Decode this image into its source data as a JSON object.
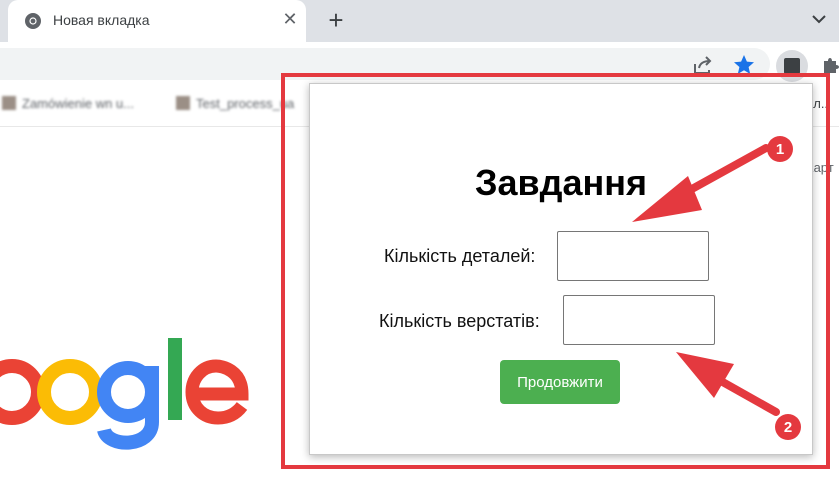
{
  "browser": {
    "tab_title": "Новая вкладка",
    "new_tab_symbol": "+",
    "tab_close_symbol": "✕",
    "bookmarks": [
      "Zamówienie wn u...",
      "Test_process_ua"
    ],
    "bookmarks_right": "ал..",
    "side_text": "Карт"
  },
  "popup": {
    "title": "Завдання",
    "fields": [
      {
        "label": "Кількість деталей:",
        "value": ""
      },
      {
        "label": "Кількість верстатів:",
        "value": ""
      }
    ],
    "submit_label": "Продовжити"
  },
  "annotations": {
    "badges": [
      "1",
      "2"
    ],
    "color": "#e4393f"
  },
  "colors": {
    "accent_button": "#4caf50",
    "tab_strip": "#dee1e6",
    "star": "#1a73e8"
  },
  "icons": [
    "chrome-favicon-icon",
    "close-icon",
    "plus-icon",
    "chevron-down-icon",
    "share-icon",
    "star-icon",
    "extension-icon",
    "puzzle-icon"
  ]
}
